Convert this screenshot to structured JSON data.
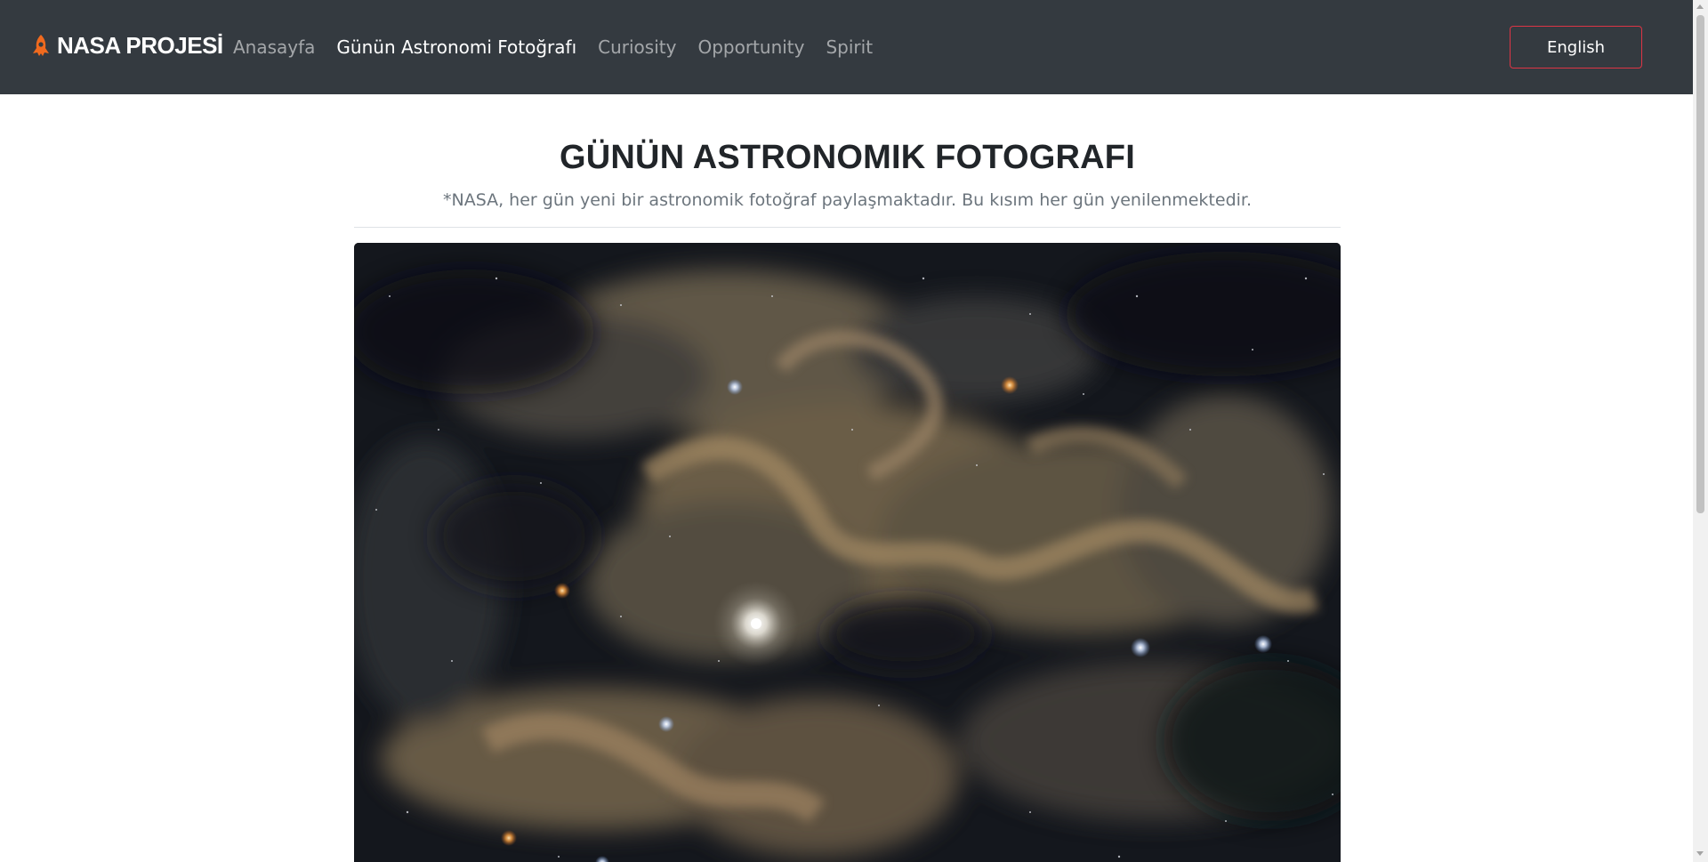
{
  "navbar": {
    "brand_label": "NASA PROJESİ",
    "brand_icon": "rocket-icon",
    "links": [
      {
        "label": "Anasayfa",
        "active": false
      },
      {
        "label": "Günün Astronomi Fotoğrafı",
        "active": true
      },
      {
        "label": "Curiosity",
        "active": false
      },
      {
        "label": "Opportunity",
        "active": false
      },
      {
        "label": "Spirit",
        "active": false
      }
    ],
    "language_button_label": "English"
  },
  "main": {
    "title": "GÜNÜN ASTRONOMIK FOTOGRAFI",
    "subtitle": "*NASA, her gün yeni bir astronomik fotoğraf paylaşmaktadır. Bu kısım her gün yenilenmektedir."
  },
  "colors": {
    "navbar_bg": "#343a40",
    "brand_accent": "#f06a1e",
    "button_border": "#dc3545",
    "title_text": "#212529",
    "subtitle_text": "#6c757d"
  }
}
